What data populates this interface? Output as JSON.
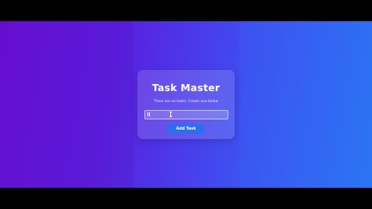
{
  "app": {
    "title": "Task Master",
    "empty_message": "There are no tasks. Create one below",
    "input": {
      "value": "",
      "placeholder": ""
    },
    "add_button_label": "Add Task",
    "icons": {
      "input_leading": "pencil-icon",
      "cursor": "text-cursor-icon"
    }
  },
  "colors": {
    "gradient_start": "#6a10d8",
    "gradient_end": "#2b73f3",
    "button": "#2b6ff0",
    "text": "#ffffff"
  }
}
